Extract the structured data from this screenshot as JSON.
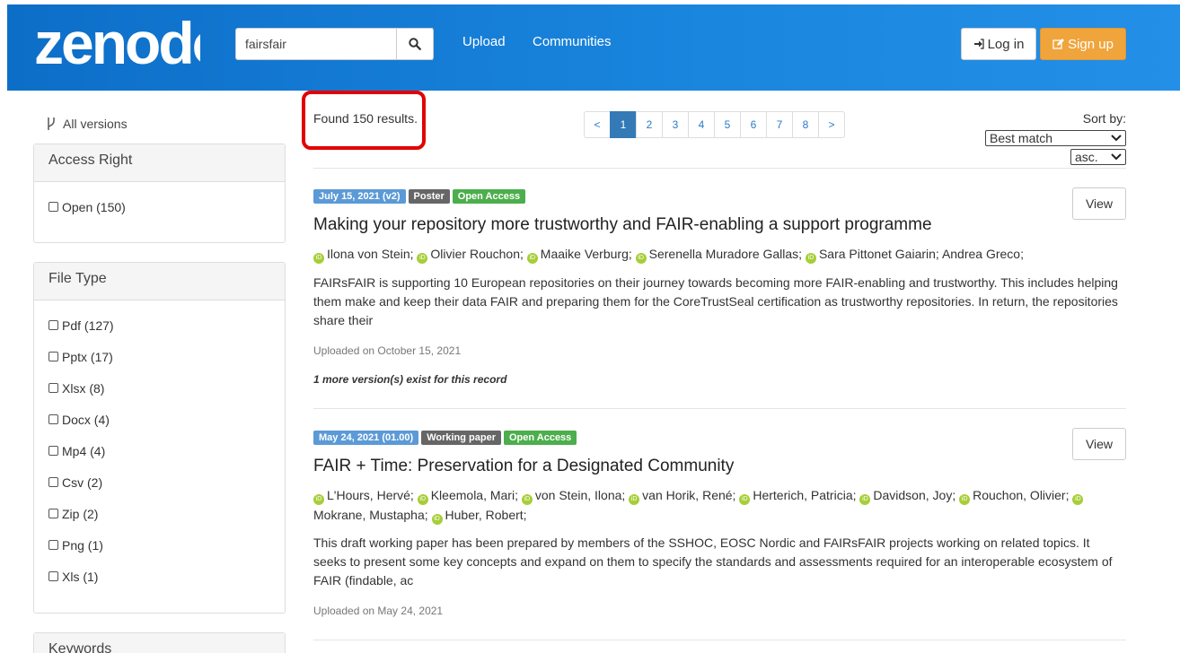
{
  "header": {
    "logo_text": "zenodo",
    "search_value": "fairsfair",
    "nav": [
      "Upload",
      "Communities"
    ],
    "login_label": "Log in",
    "signup_label": "Sign up"
  },
  "sidebar": {
    "all_versions": "All versions",
    "facets": [
      {
        "title": "Access Right",
        "items": [
          "Open (150)"
        ]
      },
      {
        "title": "File Type",
        "items": [
          "Pdf (127)",
          "Pptx (17)",
          "Xlsx (8)",
          "Docx (4)",
          "Mp4 (4)",
          "Csv (2)",
          "Zip (2)",
          "Png (1)",
          "Xls (1)"
        ]
      },
      {
        "title": "Keywords",
        "items": []
      }
    ]
  },
  "results": {
    "found_text": "Found 150 results.",
    "pages": [
      "<",
      "1",
      "2",
      "3",
      "4",
      "5",
      "6",
      "7",
      "8",
      ">"
    ],
    "active_page": "1",
    "sort_label": "Sort by:",
    "sort_by": "Best match",
    "sort_order": "asc.",
    "items": [
      {
        "date_badge": "July 15, 2021 (v2)",
        "type_badge": "Poster",
        "access_badge": "Open Access",
        "title": "Making your repository more trustworthy and FAIR-enabling a support programme",
        "authors_line1": [
          {
            "name": "Ilona von Stein;",
            "orcid": true
          },
          {
            "name": "Olivier Rouchon;",
            "orcid": true
          },
          {
            "name": "Maaike Verburg;",
            "orcid": true
          },
          {
            "name": "Serenella Muradore Gallas;",
            "orcid": true
          },
          {
            "name": "Sara Pittonet Gaiarin;",
            "orcid": true
          },
          {
            "name": "Andrea Greco;",
            "orcid": false
          }
        ],
        "authors_line2": [],
        "description": "FAIRsFAIR is supporting 10 European repositories on their journey towards becoming more FAIR-enabling and trustworthy. This includes helping them make and keep their data FAIR and preparing them for the CoreTrustSeal certification as trustworthy repositories. In return, the repositories share their",
        "uploaded": "Uploaded on October 15, 2021",
        "versions_note": "1 more version(s) exist for this record",
        "view_label": "View"
      },
      {
        "date_badge": "May 24, 2021 (01.00)",
        "type_badge": "Working paper",
        "access_badge": "Open Access",
        "title": "FAIR + Time: Preservation for a Designated Community",
        "authors_line1": [
          {
            "name": "L'Hours, Hervé;",
            "orcid": true
          },
          {
            "name": "Kleemola, Mari;",
            "orcid": true
          },
          {
            "name": "von Stein, Ilona;",
            "orcid": true
          },
          {
            "name": "van Horik, René;",
            "orcid": true
          },
          {
            "name": "Herterich, Patricia;",
            "orcid": true
          },
          {
            "name": "Davidson, Joy;",
            "orcid": true
          },
          {
            "name": "Rouchon, Olivier;",
            "orcid": true
          },
          {
            "name": "",
            "orcid": true
          }
        ],
        "authors_line2": [
          {
            "name": "Mokrane, Mustapha;",
            "orcid": true
          },
          {
            "name": "Huber, Robert;",
            "orcid": false
          }
        ],
        "description": "This draft working paper has been prepared by members of the SSHOC, EOSC Nordic and FAIRsFAIR  projects working on related topics. It seeks to present some key concepts and expand on them to specify the standards and assessments required for an interoperable ecosystem of FAIR (findable, ac",
        "uploaded": "Uploaded on May 24, 2021",
        "versions_note": "",
        "view_label": "View"
      }
    ]
  },
  "colors": {
    "header_blue": "#1a86de",
    "signup_orange": "#f0a43c",
    "active_page_blue": "#337ab7",
    "open_access_green": "#4cae4c",
    "orcid_green": "#a6ce39",
    "highlight_red": "#e30000"
  }
}
